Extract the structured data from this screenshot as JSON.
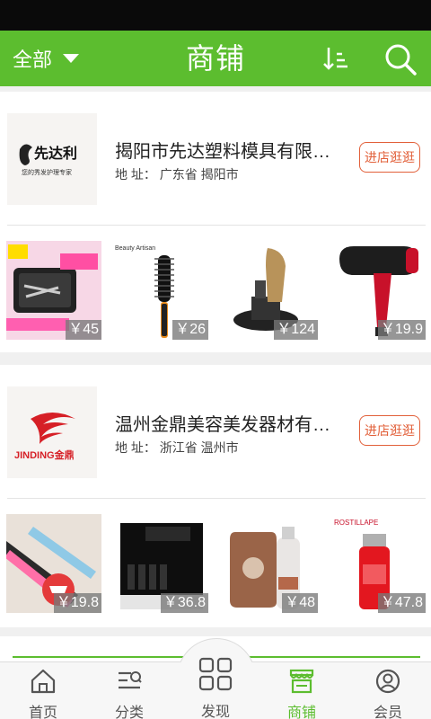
{
  "header": {
    "filter_label": "全部",
    "title": "商铺"
  },
  "shops": [
    {
      "logo_alt": "先达利",
      "logo_tagline": "您的秀发护理专家",
      "name": "揭阳市先达塑料模具有限公司",
      "address_label": "地 址：",
      "address": "广东省 揭阳市",
      "enter_label": "进店逛逛",
      "products": [
        {
          "price": "￥45"
        },
        {
          "price": "￥26"
        },
        {
          "price": "￥124"
        },
        {
          "price": "￥19.9"
        }
      ]
    },
    {
      "logo_alt": "JINDING金鼎",
      "name": "温州金鼎美容美发器材有限公...",
      "address_label": "地 址：",
      "address": "浙江省 温州市",
      "enter_label": "进店逛逛",
      "products": [
        {
          "price": "￥19.8"
        },
        {
          "price": "￥36.8"
        },
        {
          "price": "￥48"
        },
        {
          "price": "￥47.8"
        }
      ]
    }
  ],
  "tabs": [
    {
      "label": "首页",
      "icon": "home-icon"
    },
    {
      "label": "分类",
      "icon": "category-icon"
    },
    {
      "label": "发现",
      "icon": "discover-grid-icon"
    },
    {
      "label": "商铺",
      "icon": "shop-icon",
      "active": true
    },
    {
      "label": "会员",
      "icon": "member-icon"
    }
  ],
  "colors": {
    "brand_green": "#5cbd2f",
    "accent_orange": "#e2603a",
    "statusbar": "#0a0a0a"
  }
}
